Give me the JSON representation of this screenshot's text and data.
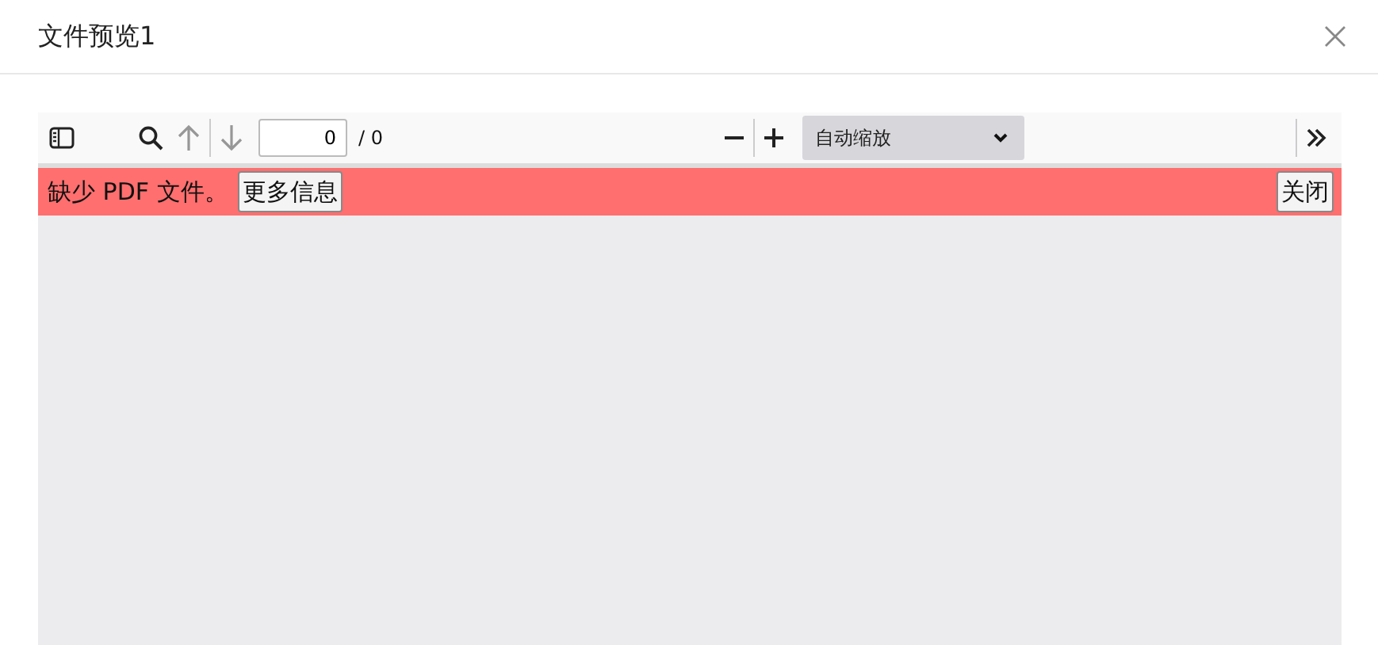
{
  "dialog": {
    "title": "文件预览1"
  },
  "toolbar": {
    "page_buttons": [
      {
        "kind": "up",
        "disabled": true
      },
      {
        "kind": "down",
        "disabled": true
      }
    ],
    "page_number": "0",
    "page_count": "/ 0",
    "zoom_select": "自动缩放"
  },
  "error_bar": {
    "message": "缺少 PDF 文件。",
    "more_button": "更多信息",
    "close_button": "关闭"
  }
}
